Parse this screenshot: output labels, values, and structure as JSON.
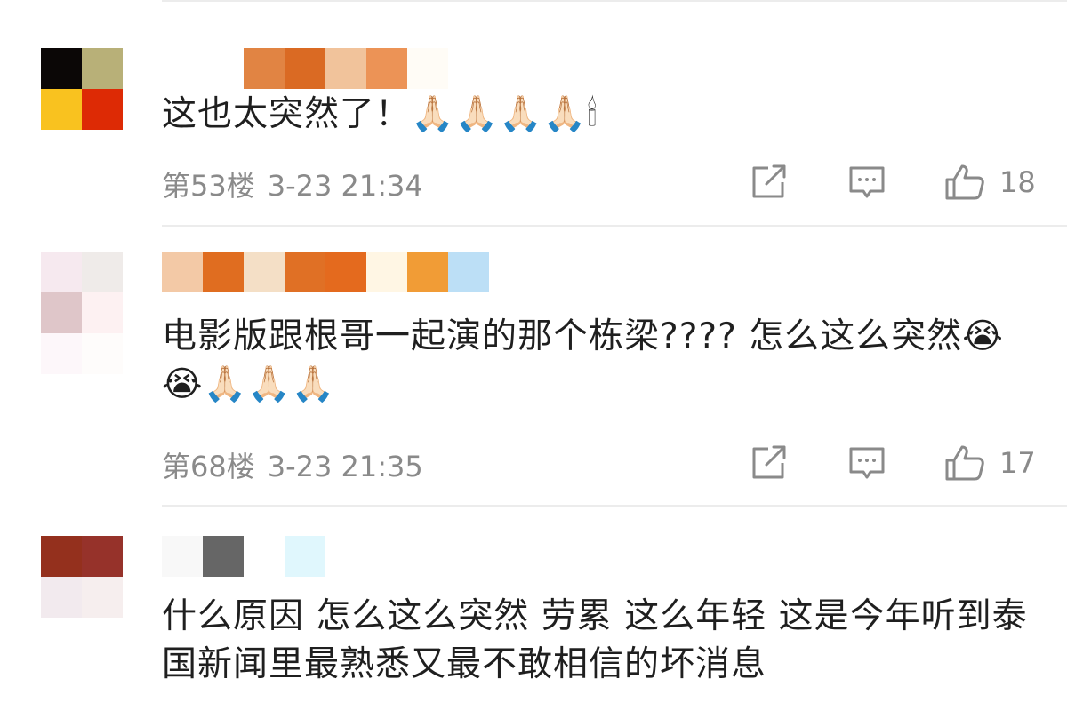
{
  "comments": [
    {
      "text": "这也太突然了！🙏🏻🙏🏻🙏🏻🙏🏻🕯",
      "floor": "第53楼",
      "time": "3-23 21:34",
      "likes": "18",
      "avatar_colors": [
        "#0b0706",
        "#b8b078",
        "#f9c21f",
        "#dd2a05"
      ],
      "name_colors": [
        "#ffffff",
        "#e18443",
        "#da6a23",
        "#f1c39b",
        "#ec9356",
        "#fffcf6"
      ]
    },
    {
      "text": "电影版跟根哥一起演的那个栋梁???? 怎么这么突然😭😭🙏🏻🙏🏻🙏🏻",
      "floor": "第68楼",
      "time": "3-23 21:35",
      "likes": "17",
      "avatar_colors": [
        "#f6e9ef",
        "#efebe9",
        "#dfc6c9",
        "#fdf1f2",
        "#fdf7fa",
        "#fefcfb"
      ],
      "name_colors": [
        "#f3c9a6",
        "#e06d20",
        "#f4dfc6",
        "#e07025",
        "#e46a1e",
        "#fff6e4",
        "#f19c36",
        "#bcdff6"
      ]
    },
    {
      "text": "什么原因 怎么这么突然 劳累  这么年轻 这是今年听到泰国新闻里最熟悉又最不敢相信的坏消息",
      "avatar_colors": [
        "#94301d",
        "#96322a",
        "#f2eaee",
        "#f6eeee"
      ],
      "name_colors": [
        "#f8f8f8",
        "#666666",
        "#ffffff",
        "#e0f7fd"
      ]
    }
  ],
  "icons": {
    "share": "share-icon",
    "reply": "reply-icon",
    "like": "thumbs-up-icon"
  },
  "colors": {
    "meta_text": "#8a8a8a",
    "divider": "#ececec",
    "icon_stroke": "#8a8a8a"
  }
}
